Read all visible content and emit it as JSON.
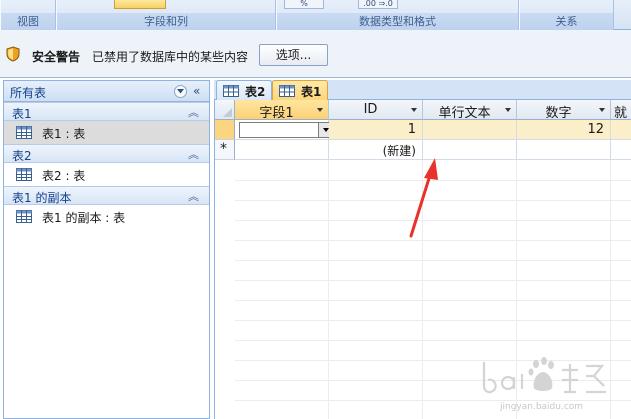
{
  "ribbon": {
    "groups": [
      {
        "label": "视图"
      },
      {
        "label": "字段和列"
      },
      {
        "label": "数据类型和格式"
      },
      {
        "label": "关系"
      }
    ],
    "mini_buttons": [
      "%",
      ".00 ⇒.0"
    ]
  },
  "message_bar": {
    "title": "安全警告",
    "text": "已禁用了数据库中的某些内容",
    "options_button": "选项..."
  },
  "nav": {
    "header": "所有表",
    "groups": [
      {
        "label": "表1",
        "items": [
          {
            "label": "表1 : 表",
            "selected": true
          }
        ]
      },
      {
        "label": "表2",
        "items": [
          {
            "label": "表2 : 表",
            "selected": false
          }
        ]
      },
      {
        "label": "表1 的副本",
        "items": [
          {
            "label": "表1 的副本 : 表",
            "selected": false
          }
        ]
      }
    ]
  },
  "tabs": [
    {
      "label": "表2",
      "active": false
    },
    {
      "label": "表1",
      "active": true
    }
  ],
  "datasheet": {
    "columns": [
      "字段1",
      "ID",
      "单行文本",
      "数字",
      "就"
    ],
    "rows": [
      {
        "字段1": "",
        "ID": "1",
        "单行文本": "",
        "数字": "12"
      }
    ],
    "new_row_marker": "*",
    "new_record_label": "(新建)"
  },
  "watermark": {
    "url": "jingyan.baidu.com"
  },
  "colors": {
    "accent": "#fbd580",
    "ribbon": "#d6e3f4",
    "annotation_arrow": "#e8322c"
  }
}
